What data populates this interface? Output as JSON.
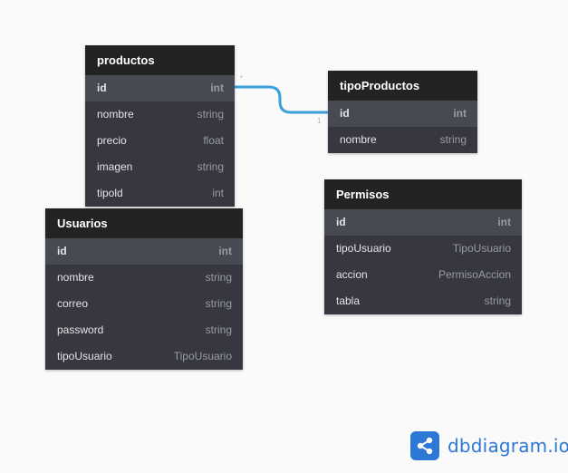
{
  "tables": {
    "productos": {
      "name": "productos",
      "fields": [
        {
          "name": "id",
          "type": "int"
        },
        {
          "name": "nombre",
          "type": "string"
        },
        {
          "name": "precio",
          "type": "float"
        },
        {
          "name": "imagen",
          "type": "string"
        },
        {
          "name": "tipold",
          "type": "int"
        }
      ]
    },
    "tipoProductos": {
      "name": "tipoProductos",
      "fields": [
        {
          "name": "id",
          "type": "int"
        },
        {
          "name": "nombre",
          "type": "string"
        }
      ]
    },
    "usuarios": {
      "name": "Usuarios",
      "fields": [
        {
          "name": "id",
          "type": "int"
        },
        {
          "name": "nombre",
          "type": "string"
        },
        {
          "name": "correo",
          "type": "string"
        },
        {
          "name": "password",
          "type": "string"
        },
        {
          "name": "tipoUsuario",
          "type": "TipoUsuario"
        }
      ]
    },
    "permisos": {
      "name": "Permisos",
      "fields": [
        {
          "name": "id",
          "type": "int"
        },
        {
          "name": "tipoUsuario",
          "type": "TipoUsuario"
        },
        {
          "name": "accion",
          "type": "PermisoAccion"
        },
        {
          "name": "tabla",
          "type": "string"
        }
      ]
    }
  },
  "relationship": {
    "from_label": "*",
    "to_label": "1",
    "color": "#3b9fd9"
  },
  "logo": {
    "text": "dbdiagram.io",
    "icon": "share-nodes-icon",
    "color": "#2c78d4"
  }
}
